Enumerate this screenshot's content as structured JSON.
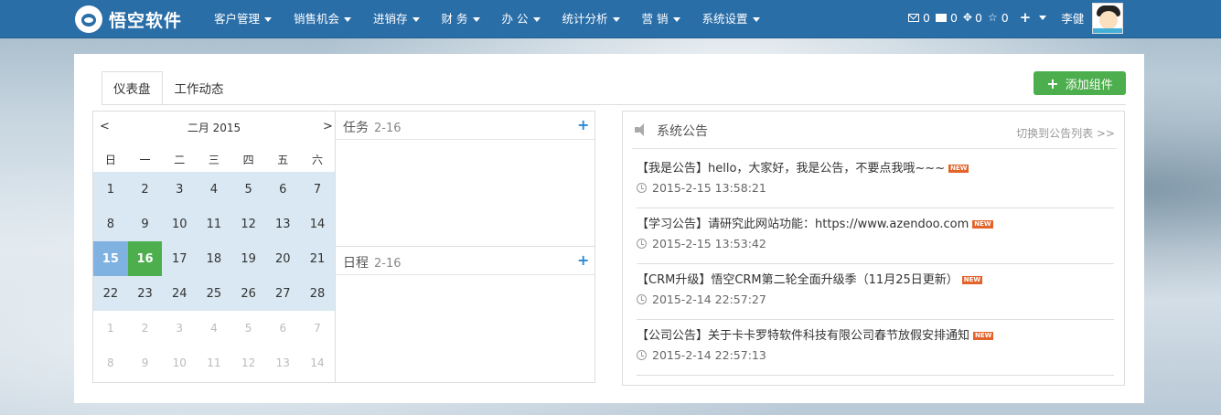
{
  "app": {
    "name": "悟空软件"
  },
  "menu": [
    {
      "label": "客户管理"
    },
    {
      "label": "销售机会"
    },
    {
      "label": "进销存"
    },
    {
      "label": "财 务"
    },
    {
      "label": "办 公"
    },
    {
      "label": "统计分析"
    },
    {
      "label": "营 销"
    },
    {
      "label": "系统设置"
    }
  ],
  "toolbar": {
    "mail_count": "0",
    "folder_count": "0",
    "cross_count": "0",
    "star_count": "0",
    "user_name": "李健"
  },
  "tabs": [
    {
      "label": "仪表盘",
      "active": true
    },
    {
      "label": "工作动态",
      "active": false
    }
  ],
  "add_widget_label": "添加组件",
  "calendar": {
    "prev": "<",
    "next": ">",
    "title": "二月 2015",
    "weekdays": [
      "日",
      "一",
      "二",
      "三",
      "四",
      "五",
      "六"
    ],
    "rows": [
      [
        "1",
        "2",
        "3",
        "4",
        "5",
        "6",
        "7"
      ],
      [
        "8",
        "9",
        "10",
        "11",
        "12",
        "13",
        "14"
      ],
      [
        "15",
        "16",
        "17",
        "18",
        "19",
        "20",
        "21"
      ],
      [
        "22",
        "23",
        "24",
        "25",
        "26",
        "27",
        "28"
      ],
      [
        "1",
        "2",
        "3",
        "4",
        "5",
        "6",
        "7"
      ],
      [
        "8",
        "9",
        "10",
        "11",
        "12",
        "13",
        "14"
      ]
    ],
    "selected": "15",
    "today": "16"
  },
  "tasks": {
    "title": "任务",
    "date": "2-16"
  },
  "schedule": {
    "title": "日程",
    "date": "2-16"
  },
  "announcements": {
    "title": "系统公告",
    "switch_label": "切换到公告列表 >>",
    "new_badge": "NEW",
    "items": [
      {
        "text": "【我是公告】hello，大家好，我是公告，不要点我哦~~~",
        "time": "2015-2-15  13:58:21"
      },
      {
        "text": "【学习公告】请研究此网站功能：https://www.azendoo.com",
        "time": "2015-2-15  13:53:42"
      },
      {
        "text": "【CRM升级】悟空CRM第二轮全面升级季（11月25日更新）",
        "time": "2015-2-14  22:57:27"
      },
      {
        "text": "【公司公告】关于卡卡罗特软件科技有限公司春节放假安排通知",
        "time": "2015-2-14  22:57:13"
      }
    ]
  },
  "colors": {
    "topbar": "#2a6ea8",
    "accent_green": "#4cae4c",
    "selected_blue": "#7fb2e0",
    "badge": "#e2642a"
  }
}
